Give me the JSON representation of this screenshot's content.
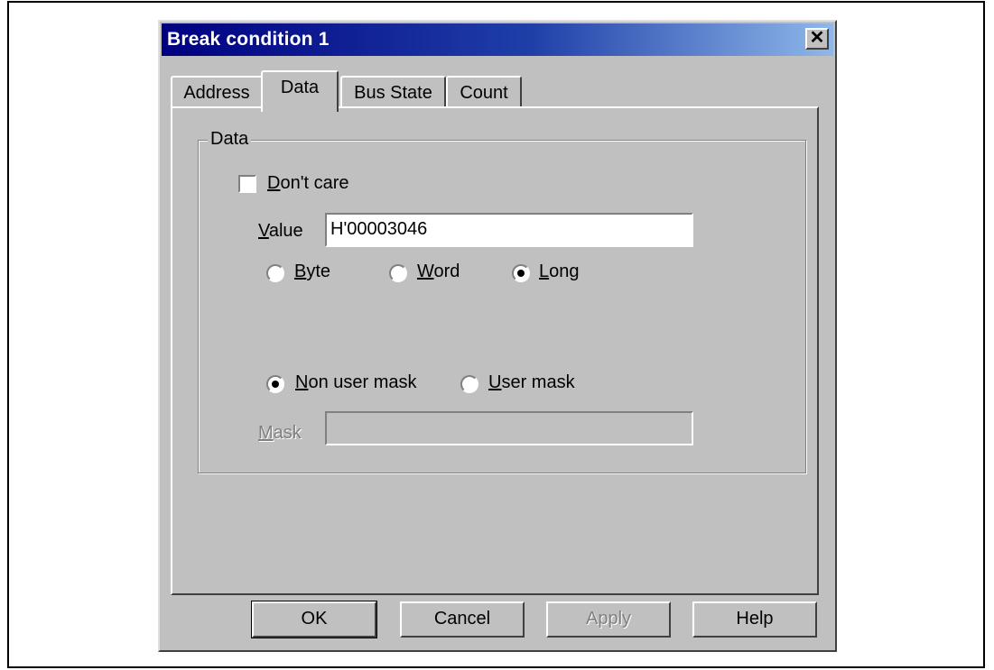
{
  "dialog": {
    "title": "Break condition 1",
    "close_glyph": "✕"
  },
  "tabs": [
    {
      "label": "Address",
      "active": false
    },
    {
      "label": "Data",
      "active": true
    },
    {
      "label": "Bus State",
      "active": false
    },
    {
      "label": "Count",
      "active": false
    }
  ],
  "data_group": {
    "legend": "Data",
    "dont_care": {
      "label": "Don't care",
      "checked": false
    },
    "value": {
      "label": "Value",
      "value": "H'00003046"
    },
    "size_options": [
      {
        "label": "Byte",
        "selected": false
      },
      {
        "label": "Word",
        "selected": false
      },
      {
        "label": "Long",
        "selected": true
      }
    ],
    "mask_options": [
      {
        "label": "Non user mask",
        "selected": true
      },
      {
        "label": "User mask",
        "selected": false
      }
    ],
    "mask": {
      "label": "Mask",
      "value": "",
      "enabled": false
    }
  },
  "buttons": {
    "ok": "OK",
    "cancel": "Cancel",
    "apply": "Apply",
    "help": "Help"
  },
  "colors": {
    "title_start": "#000080",
    "title_end": "#8fb8ea",
    "face": "#c0c0c0"
  }
}
